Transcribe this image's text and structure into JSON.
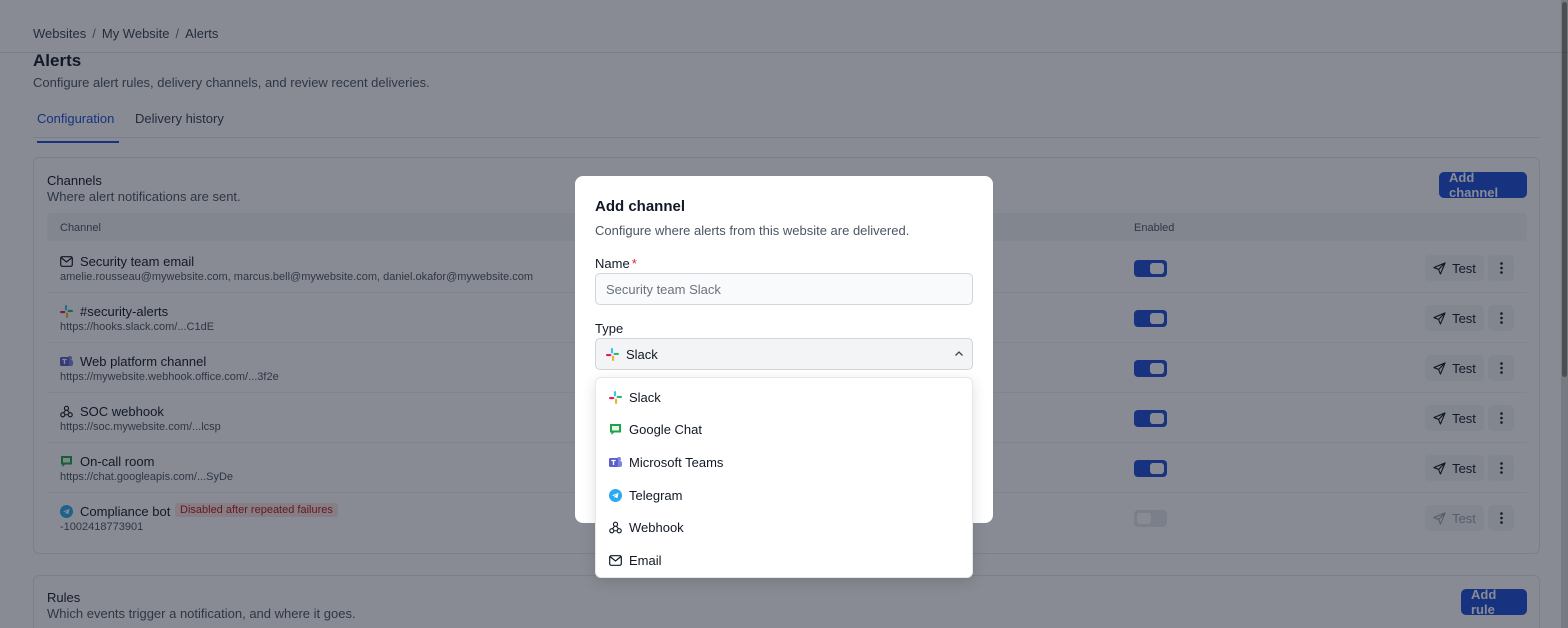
{
  "breadcrumb": {
    "items": [
      "Websites",
      "My Website",
      "Alerts"
    ],
    "separator": "/"
  },
  "page": {
    "title": "Alerts",
    "subtitle": "Configure alert rules, delivery channels, and review recent deliveries."
  },
  "tabs": [
    {
      "label": "Configuration",
      "active": true
    },
    {
      "label": "Delivery history",
      "active": false
    }
  ],
  "channels_card": {
    "title": "Channels",
    "description": "Where alert notifications are sent.",
    "add_label": "Add channel",
    "columns": {
      "channel": "Channel",
      "enabled": "Enabled"
    },
    "test_label": "Test",
    "rows": [
      {
        "name": "Security team email",
        "icon": "mail-icon",
        "destination": "amelie.rousseau@mywebsite.com, marcus.bell@mywebsite.com, daniel.okafor@mywebsite.com",
        "enabled": true,
        "badge": ""
      },
      {
        "name": "#security-alerts",
        "icon": "slack-icon",
        "destination": "https://hooks.slack.com/...C1dE",
        "enabled": true,
        "badge": ""
      },
      {
        "name": "Web platform channel",
        "icon": "teams-icon",
        "destination": "https://mywebsite.webhook.office.com/...3f2e",
        "enabled": true,
        "badge": ""
      },
      {
        "name": "SOC webhook",
        "icon": "webhook-icon",
        "destination": "https://soc.mywebsite.com/...lcsp",
        "enabled": true,
        "badge": ""
      },
      {
        "name": "On-call room",
        "icon": "google-chat-icon",
        "destination": "https://chat.googleapis.com/...SyDe",
        "enabled": true,
        "badge": ""
      },
      {
        "name": "Compliance bot",
        "icon": "telegram-icon",
        "destination": "-1002418773901",
        "enabled": false,
        "badge": "Disabled after repeated failures"
      }
    ]
  },
  "rules_card": {
    "title": "Rules",
    "description": "Which events trigger a notification, and where it goes.",
    "add_label": "Add rule"
  },
  "modal": {
    "title": "Add channel",
    "description": "Configure where alerts from this website are delivered.",
    "name_label": "Name",
    "required_mark": "*",
    "name_placeholder": "Security team Slack",
    "type_label": "Type",
    "type_selected": "Slack",
    "type_selected_icon": "slack-icon",
    "type_options": [
      {
        "label": "Slack",
        "icon": "slack-icon"
      },
      {
        "label": "Google Chat",
        "icon": "google-chat-icon"
      },
      {
        "label": "Microsoft Teams",
        "icon": "teams-icon"
      },
      {
        "label": "Telegram",
        "icon": "telegram-icon"
      },
      {
        "label": "Webhook",
        "icon": "webhook-icon"
      },
      {
        "label": "Email",
        "icon": "mail-icon"
      }
    ]
  },
  "colors": {
    "primary": "#1d4ed8",
    "danger": "#dc2626",
    "slack_red": "#e01e5a",
    "slack_blue": "#36c5f0",
    "slack_green": "#2eb67d",
    "slack_yellow": "#ecb22e",
    "teams": "#5b5fc7",
    "google_chat": "#1ea446",
    "telegram": "#2aabee"
  }
}
